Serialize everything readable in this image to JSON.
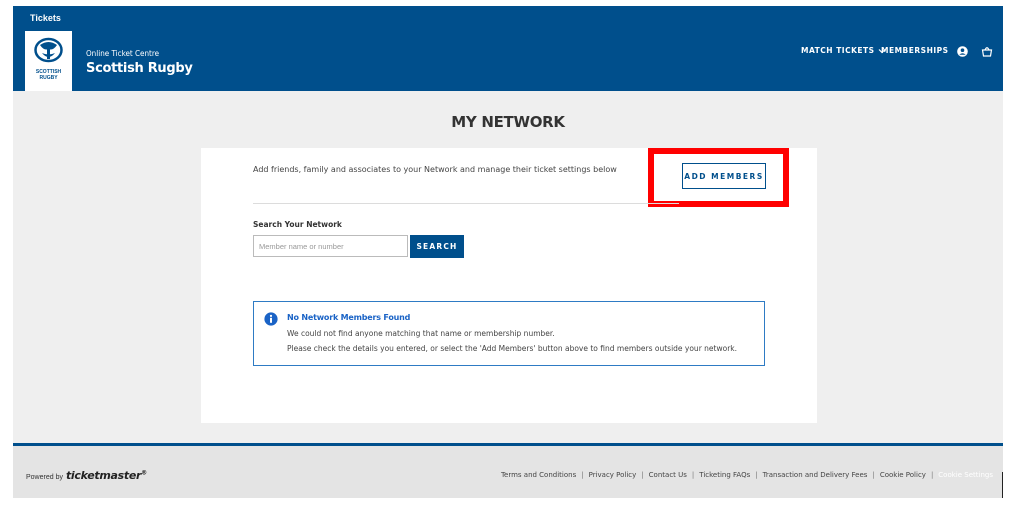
{
  "header": {
    "tickets_label": "Tickets",
    "logo_text_line1": "SCOTTISH",
    "logo_text_line2": "RUGBY",
    "brand_sub": "Online Ticket Centre",
    "brand_main": "Scottish Rugby",
    "nav": {
      "match_tickets": "MATCH TICKETS",
      "memberships": "MEMBERSHIPS"
    },
    "icons": {
      "user": "user-icon",
      "basket": "basket-icon",
      "chevron": "chevron-down-icon"
    }
  },
  "main": {
    "title": "MY NETWORK",
    "intro": "Add friends, family and associates to your Network and manage their ticket settings below",
    "add_members_label": "ADD MEMBERS",
    "search": {
      "label": "Search Your Network",
      "placeholder": "Member name or number",
      "value": "",
      "button_label": "SEARCH"
    },
    "notice": {
      "icon": "info-icon",
      "title": "No Network Members Found",
      "line1": "We could not find anyone matching that name or membership number.",
      "line2": "Please check the details you entered, or select the 'Add Members' button above to find members outside your network."
    }
  },
  "footer": {
    "powered_by": "Powered by",
    "brand": "ticketmaster",
    "brand_mark": "®",
    "links": [
      "Terms and Conditions",
      "Privacy Policy",
      "Contact Us",
      "Ticketing FAQs",
      "Transaction and Delivery Fees",
      "Cookie Policy",
      "Cookie Settings"
    ]
  },
  "colors": {
    "brand_blue": "#004f8c",
    "highlight_red": "#ff0000",
    "notice_blue": "#2e7bc4",
    "page_bg": "#efefef"
  }
}
